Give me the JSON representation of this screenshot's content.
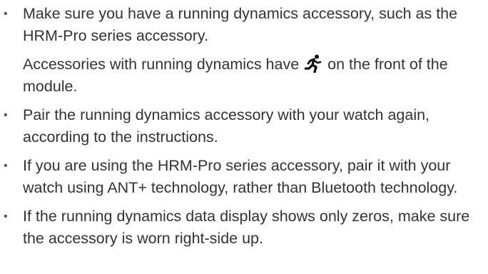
{
  "items": [
    {
      "text": "Make sure you have a running dynamics accessory, such as the HRM-Pro series accessory.",
      "note_before": "Accessories with running dynamics have",
      "note_icon": "running-person-icon",
      "note_after": "on the front of the module."
    },
    {
      "text": "Pair the running dynamics accessory with your watch again, according to the instructions."
    },
    {
      "text": "If you are using the HRM-Pro series accessory, pair it with your watch using ANT+ technology, rather than Bluetooth technology."
    },
    {
      "text": "If the running dynamics data display shows only zeros, make sure the accessory is worn right-side up."
    }
  ],
  "bullet_char": "•"
}
